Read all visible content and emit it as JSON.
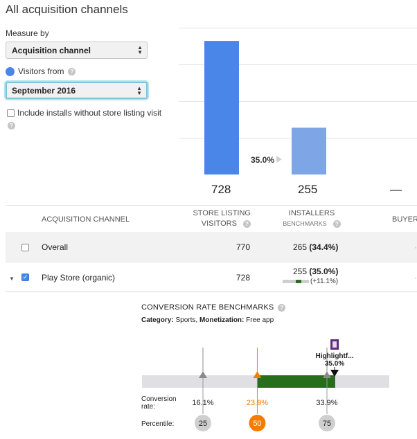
{
  "page": {
    "title": "All acquisition channels"
  },
  "controls": {
    "measure_label": "Measure by",
    "measure_value": "Acquisition channel",
    "visitors_label": "Visitors from",
    "visitors_value": "September 2016",
    "include_label": "Include installs without store listing visit"
  },
  "summary": {
    "visitors": "728",
    "installers": "255",
    "buyers": "—",
    "conversion": "35.0%"
  },
  "chart_data": {
    "type": "bar",
    "categories": [
      "Store listing visitors",
      "Installers"
    ],
    "values": [
      728,
      255
    ],
    "ylim": [
      0,
      800
    ],
    "grid": true,
    "colors": [
      "#4a86e8",
      "#7ea6e6"
    ],
    "annotations": [
      "35.0%"
    ]
  },
  "table": {
    "headers": {
      "channel": "ACQUISITION CHANNEL",
      "slv_line1": "STORE LISTING",
      "slv_line2": "VISITORS",
      "inst_line1": "INSTALLERS",
      "inst_line2": "BENCHMARKS",
      "buyers": "BUYER"
    },
    "rows": [
      {
        "channel": "Overall",
        "visitors": "770",
        "installers": "265",
        "installers_pct": "(34.4%)",
        "checked": false
      },
      {
        "channel": "Play Store (organic)",
        "visitors": "728",
        "installers": "255",
        "installers_pct": "(35.0%)",
        "delta": "(+11.1%)",
        "checked": true
      }
    ]
  },
  "benchmarks": {
    "title": "CONVERSION RATE BENCHMARKS",
    "category_label": "Category:",
    "category_value": "Sports,",
    "monetization_label": "Monetization:",
    "monetization_value": "Free app",
    "highlight_name": "Highlightf...",
    "highlight_value": "35.0%",
    "conversion_label_1": "Conversion",
    "conversion_label_2": "rate:",
    "percentile_label": "Percentile:",
    "markers": [
      {
        "rate": "16.1%",
        "percentile": "25",
        "color": "#8a8a8a"
      },
      {
        "rate": "23.9%",
        "percentile": "50",
        "color": "#f57c00"
      },
      {
        "rate": "33.9%",
        "percentile": "75",
        "color": "#8a8a8a"
      }
    ],
    "colors": {
      "bar_bg": "#e0e0e4",
      "bar_fill": "#276e1a",
      "median": "#f57c00"
    }
  }
}
